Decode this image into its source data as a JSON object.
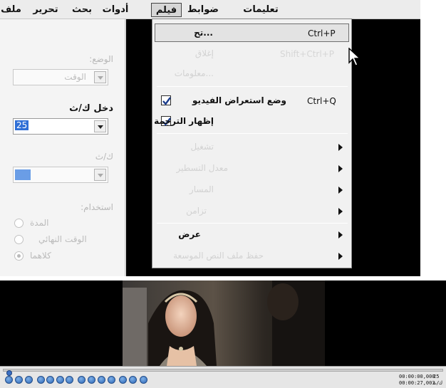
{
  "menubar": {
    "items": [
      {
        "label": "ملف"
      },
      {
        "label": "تحرير"
      },
      {
        "label": "بحث"
      },
      {
        "label": "أدوات"
      },
      {
        "label": "فيلم"
      },
      {
        "label": "ضوابط"
      },
      {
        "label": "تعليمات"
      }
    ],
    "active_index": 4
  },
  "left_panel": {
    "mode_label": ":الوضع",
    "mode_value": "الوقت",
    "input_fps_label": "دخل ك/ث",
    "input_fps_value": "25",
    "fps_label": "ك/ث",
    "use_label": ":استخدام",
    "radios": [
      {
        "label": "المدة",
        "checked": false
      },
      {
        "label": "الوقت النهائي",
        "checked": false
      },
      {
        "label": "كلاهما",
        "checked": true
      }
    ]
  },
  "dropdown": {
    "items": [
      {
        "label": "...تح",
        "shortcut": "Ctrl+P",
        "enabled": true,
        "hover": true
      },
      {
        "label": "إغلاق",
        "shortcut": "Shift+Ctrl+P",
        "enabled": false
      },
      {
        "label": "...معلومات",
        "shortcut": "",
        "enabled": false
      },
      {
        "label": "وضع استعراض الفيديو",
        "shortcut": "Ctrl+Q",
        "enabled": true,
        "checked": true
      },
      {
        "label": "إظهار الترجمة",
        "shortcut": "",
        "enabled": true,
        "checked": true
      },
      {
        "label": "تشغيل",
        "enabled": false,
        "submenu": true
      },
      {
        "label": "معدل التسطير",
        "enabled": false,
        "submenu": true
      },
      {
        "label": "المسار",
        "enabled": false,
        "submenu": true
      },
      {
        "label": "تزامن",
        "enabled": false,
        "submenu": true
      },
      {
        "label": "عرض",
        "enabled": true,
        "submenu": true
      },
      {
        "label": "حفظ ملف النص الموسعة",
        "enabled": false,
        "submenu": true
      }
    ]
  },
  "player": {
    "current_time": "00:00:00,000",
    "total_time": "00:00:27,003",
    "fps_value": "25",
    "fps_unit": "ك/ث"
  },
  "colors": {
    "menu_background": "#f1f1f1",
    "selection_blue": "#2f6fd6",
    "player_button_blue": "#2c67b8"
  }
}
